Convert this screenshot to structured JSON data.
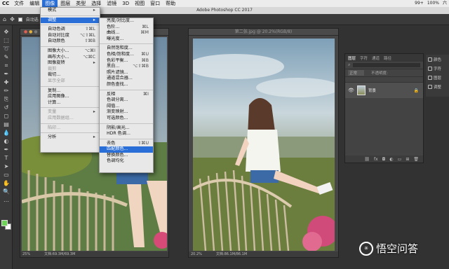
{
  "menubar": {
    "app": "CC",
    "items": [
      "文件",
      "编辑",
      "图像",
      "图层",
      "类型",
      "选择",
      "滤镜",
      "3D",
      "视图",
      "窗口",
      "帮助"
    ],
    "active_index": 2,
    "status_right": [
      "99+",
      "100%",
      "六"
    ]
  },
  "window_title": "Adobe Photoshop CC 2017",
  "options_bar": {
    "auto_select_label": "自动选"
  },
  "doc1": {
    "zoom": "25%",
    "doc_size": "文档:69.3M/69.3M"
  },
  "doc2": {
    "tab": "第二张.jpg @ 20.2%(RGB/8)",
    "zoom": "20.2%",
    "doc_size": "文档:86.1M/86.1M"
  },
  "image_menu": {
    "items": [
      {
        "label": "模式",
        "shortcut": "▸",
        "disabled": false
      },
      {
        "sep": true
      },
      {
        "label": "调整",
        "shortcut": "▸",
        "highlight": true
      },
      {
        "sep": true
      },
      {
        "label": "自动色调",
        "shortcut": "⇧⌘L"
      },
      {
        "label": "自动对比度",
        "shortcut": "⌥⇧⌘L"
      },
      {
        "label": "自动颜色",
        "shortcut": "⇧⌘B"
      },
      {
        "sep": true
      },
      {
        "label": "图像大小...",
        "shortcut": "⌥⌘I"
      },
      {
        "label": "画布大小...",
        "shortcut": "⌥⌘C"
      },
      {
        "label": "图像旋转",
        "shortcut": "▸"
      },
      {
        "label": "裁剪",
        "disabled": true
      },
      {
        "label": "裁切..."
      },
      {
        "label": "显示全部",
        "disabled": true
      },
      {
        "sep": true
      },
      {
        "label": "复制..."
      },
      {
        "label": "应用图像..."
      },
      {
        "label": "计算..."
      },
      {
        "sep": true
      },
      {
        "label": "变量",
        "shortcut": "▸",
        "disabled": true
      },
      {
        "label": "应用数据组...",
        "disabled": true
      },
      {
        "sep": true
      },
      {
        "label": "陷印...",
        "disabled": true
      },
      {
        "sep": true
      },
      {
        "label": "分析",
        "shortcut": "▸"
      }
    ]
  },
  "adjust_menu": {
    "items": [
      {
        "label": "亮度/对比度..."
      },
      {
        "label": "色阶...",
        "shortcut": "⌘L"
      },
      {
        "label": "曲线...",
        "shortcut": "⌘M"
      },
      {
        "label": "曝光度..."
      },
      {
        "sep": true
      },
      {
        "label": "自然饱和度..."
      },
      {
        "label": "色相/饱和度...",
        "shortcut": "⌘U"
      },
      {
        "label": "色彩平衡...",
        "shortcut": "⌘B"
      },
      {
        "label": "黑白...",
        "shortcut": "⌥⇧⌘B"
      },
      {
        "label": "照片滤镜..."
      },
      {
        "label": "通道混合器..."
      },
      {
        "label": "颜色查找..."
      },
      {
        "sep": true
      },
      {
        "label": "反相",
        "shortcut": "⌘I"
      },
      {
        "label": "色调分离..."
      },
      {
        "label": "阈值..."
      },
      {
        "label": "渐变映射..."
      },
      {
        "label": "可选颜色..."
      },
      {
        "sep": true
      },
      {
        "label": "阴影/高光..."
      },
      {
        "label": "HDR 色调..."
      },
      {
        "sep": true
      },
      {
        "label": "去色",
        "shortcut": "⇧⌘U"
      },
      {
        "label": "匹配颜色...",
        "highlight": true
      },
      {
        "label": "替换颜色..."
      },
      {
        "label": "色调均化"
      }
    ]
  },
  "layers_panel": {
    "tabs": [
      "图层",
      "字符",
      "通道",
      "路径"
    ],
    "mode": "正常",
    "opacity_label": "不透明度:",
    "layer_name": "背景"
  },
  "right_column": [
    "颜色",
    "字符",
    "图层",
    "调整"
  ],
  "watermark": {
    "text": "悟空问答"
  },
  "colors": {
    "accent": "#2a6fd8",
    "foreground": "#6fd35a",
    "background": "#ffffff"
  }
}
